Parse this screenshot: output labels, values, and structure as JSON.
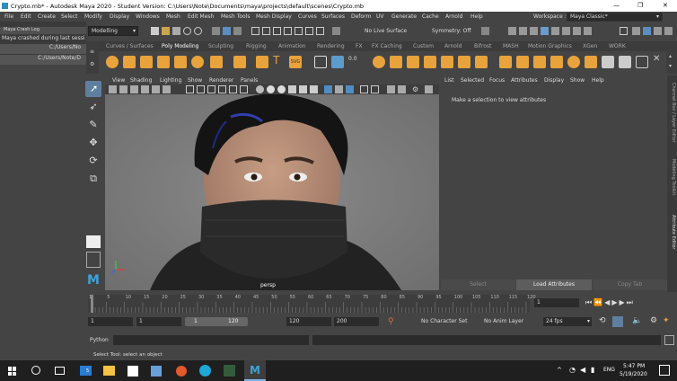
{
  "window": {
    "title": "Crypto.mb* - Autodesk Maya 2020 - Student Version: C:\\Users\\Note\\Documents\\maya\\projects\\default\\scenes\\Crypto.mb",
    "minimize": "—",
    "maximize": "❐",
    "close": "✕"
  },
  "menubar": [
    "File",
    "Edit",
    "Create",
    "Select",
    "Modify",
    "Display",
    "Windows",
    "Mesh",
    "Edit Mesh",
    "Mesh Tools",
    "Mesh Display",
    "Curves",
    "Surfaces",
    "Deform",
    "UV",
    "Generate",
    "Cache",
    "Arnold",
    "Help"
  ],
  "workspace": {
    "label": "Workspace :",
    "value": "Maya Classic*"
  },
  "status": {
    "menuset": "Modelling",
    "live_surface": "No Live Surface",
    "symmetry": "Symmetry: Off"
  },
  "crashlog": {
    "title": "Maya Crash Log",
    "message": "Maya crashed during last sessi",
    "path1": "C:/Users/No",
    "path2": "C:/Users/Note/D"
  },
  "shelf_tabs": [
    "Curves / Surfaces",
    "Poly Modeling",
    "Sculpting",
    "Rigging",
    "Animation",
    "Rendering",
    "FX",
    "FX Caching",
    "Custom",
    "Arnold",
    "Bifrost",
    "MASH",
    "Motion Graphics",
    "XGen",
    "WORK"
  ],
  "active_shelf": "Poly Modeling",
  "viewport": {
    "menu": [
      "View",
      "Shading",
      "Lighting",
      "Show",
      "Renderer",
      "Panels"
    ],
    "camera": "persp"
  },
  "attr_editor": {
    "menu": [
      "List",
      "Selected",
      "Focus",
      "Attributes",
      "Display",
      "Show",
      "Help"
    ],
    "message": "Make a selection to view attributes",
    "select": "Select",
    "load": "Load Attributes",
    "copy": "Copy Tab"
  },
  "right_tabs": [
    "Channel Box / Layer Editor",
    "Modeling Toolkit",
    "Attribute Editor"
  ],
  "timeline": {
    "ticks": [
      "5",
      "10",
      "15",
      "20",
      "25",
      "30",
      "35",
      "40",
      "45",
      "50",
      "55",
      "60",
      "65",
      "70",
      "75",
      "80",
      "85",
      "90",
      "95",
      "100",
      "105",
      "110",
      "115",
      "120"
    ],
    "start_tick": "1",
    "current_frame": "1"
  },
  "range": {
    "start": "1",
    "playback_start": "1",
    "slider_start": "1",
    "slider_end": "120",
    "playback_end": "120",
    "end": "200",
    "character_set": "No Character Set",
    "anim_layer": "No Anim Layer",
    "fps": "24 fps"
  },
  "python_label": "Python",
  "help_line": "Select Tool: select an object",
  "taskbar": {
    "lang": "ENG",
    "time": "5:47 PM",
    "date": "5/19/2020",
    "mail_badge": "5"
  }
}
